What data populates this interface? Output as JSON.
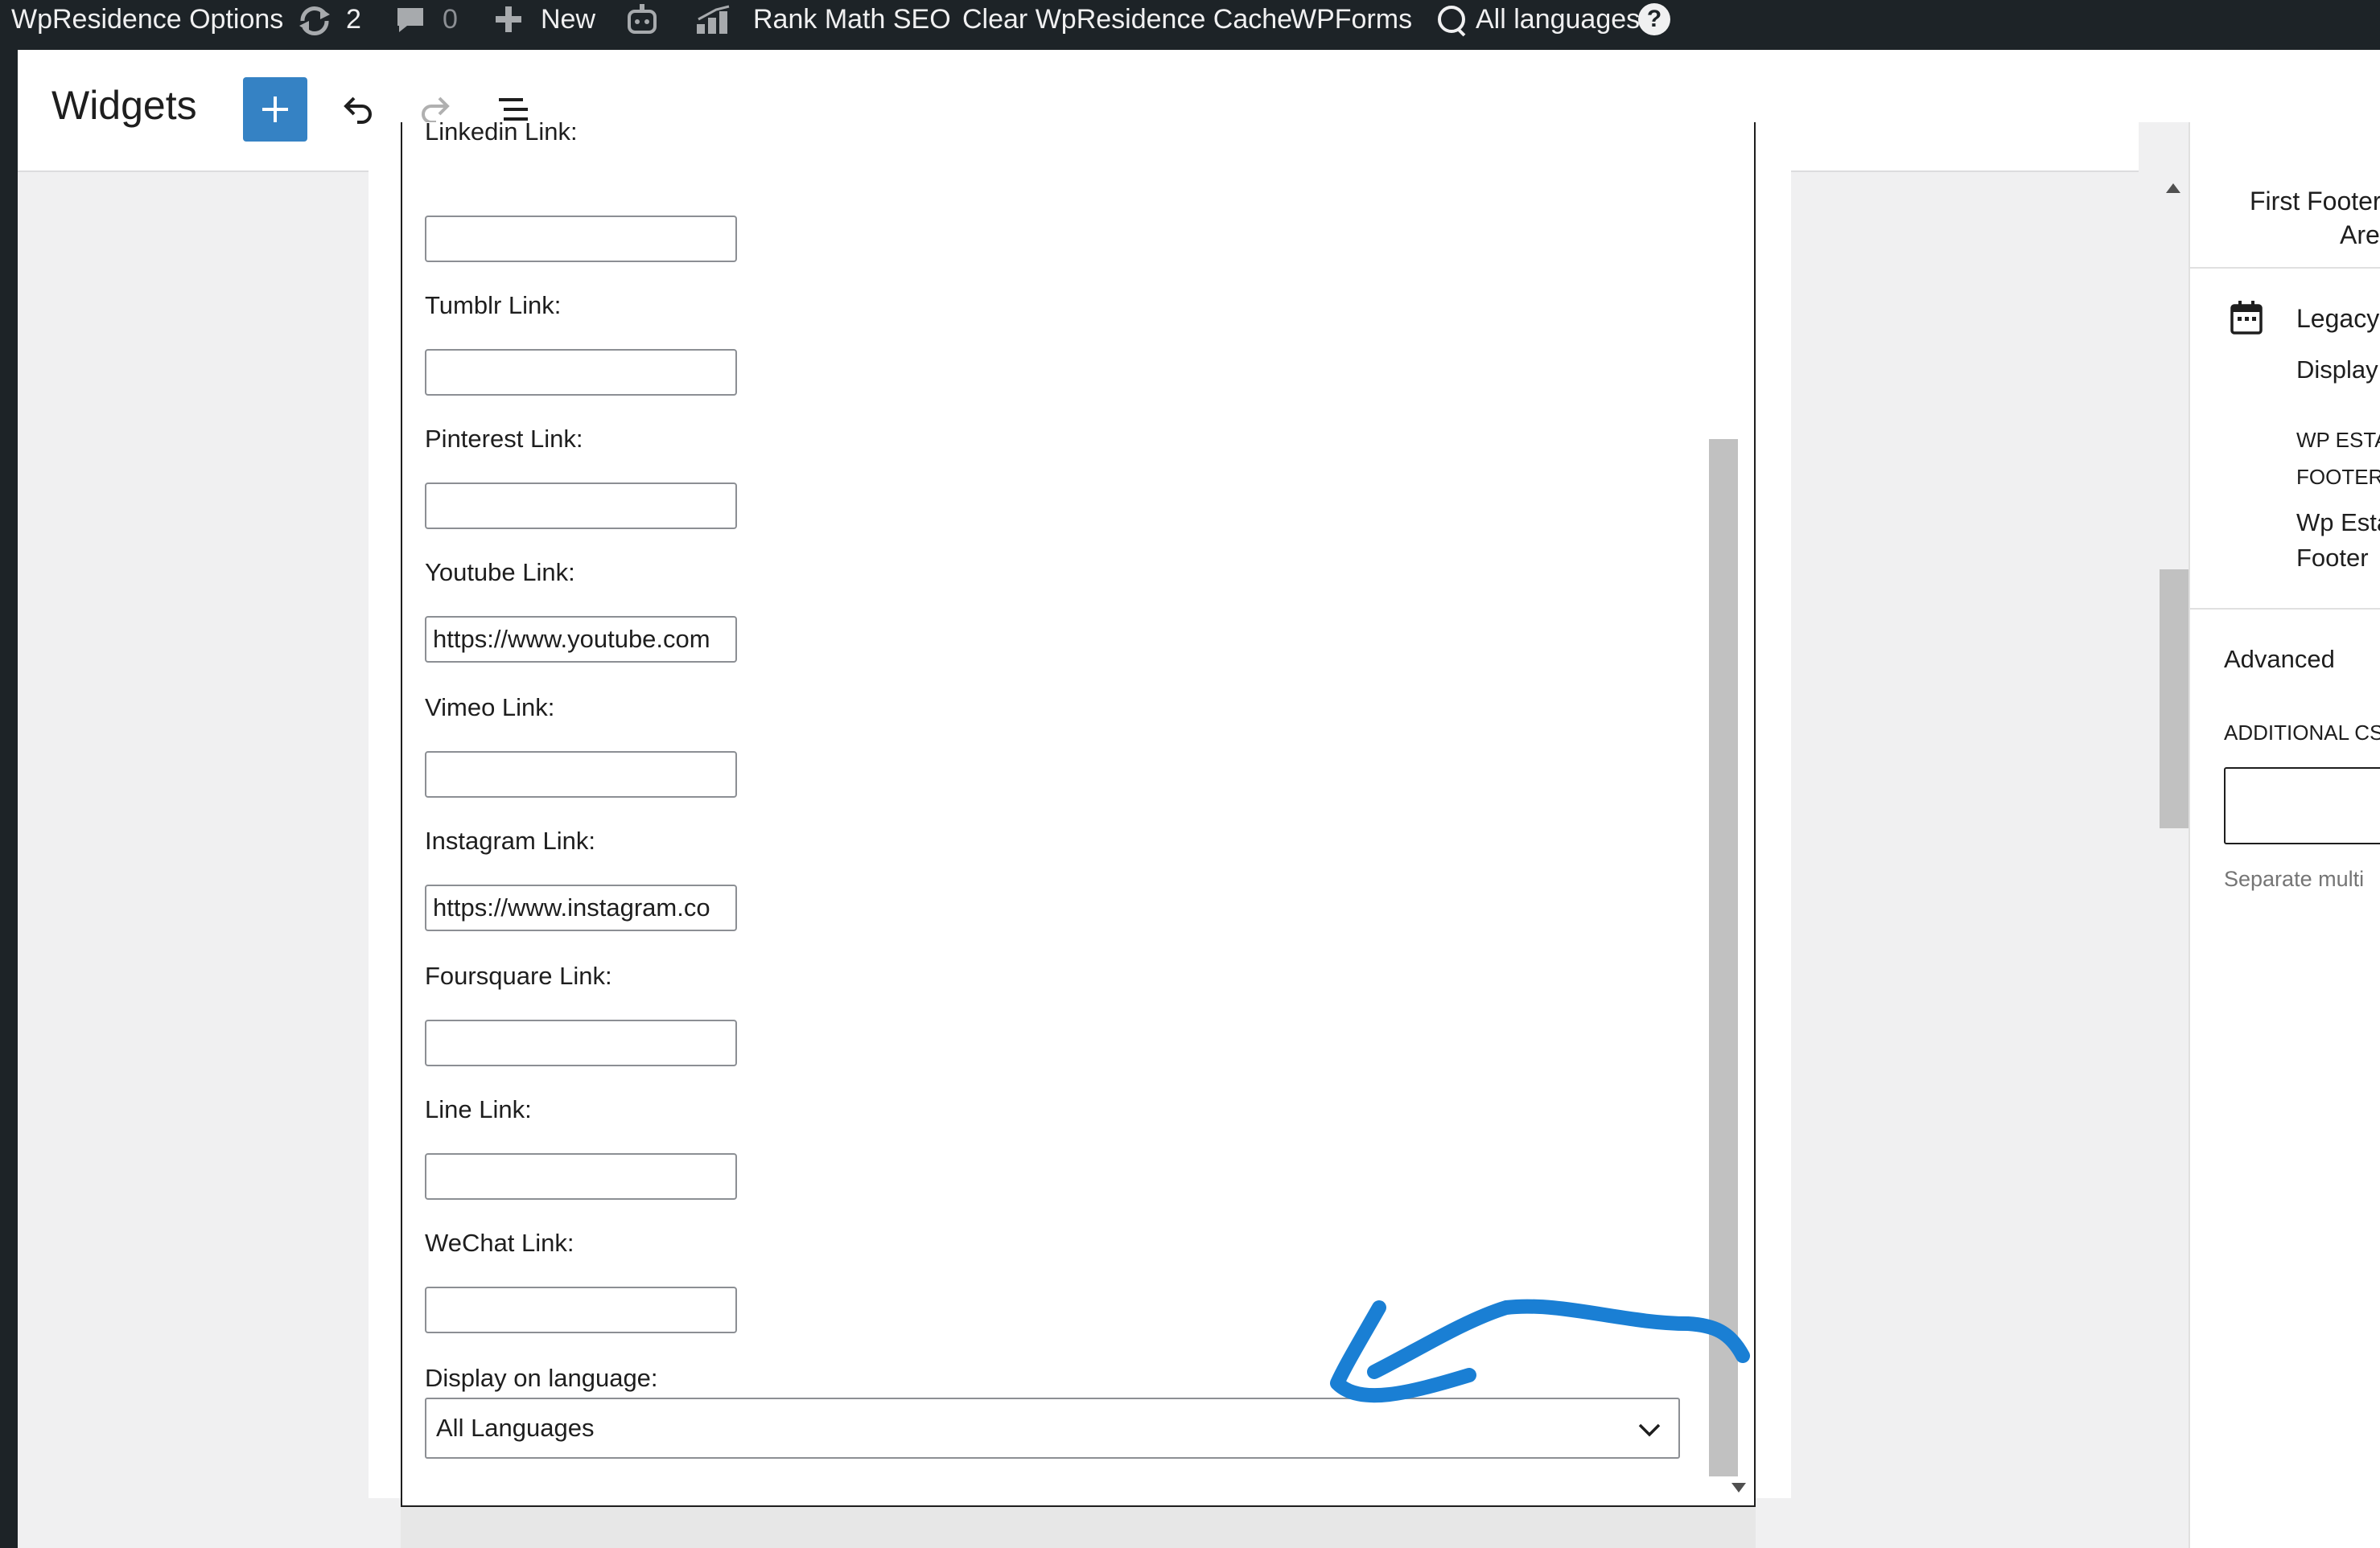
{
  "admin_bar": {
    "site_options": "WpResidence Options",
    "updates_count": "2",
    "comments_count": "0",
    "new_label": "New",
    "rank_math": "Rank Math SEO",
    "clear_cache": "Clear WpResidence Cache",
    "wpforms": "WPForms",
    "languages": "All languages",
    "help_glyph": "?"
  },
  "header": {
    "title": "Widgets",
    "add_glyph": "+"
  },
  "form": {
    "fields": [
      {
        "label": "Linkedin Link:",
        "value": ""
      },
      {
        "label": "Tumblr Link:",
        "value": ""
      },
      {
        "label": "Pinterest Link:",
        "value": ""
      },
      {
        "label": "Youtube Link:",
        "value": "https://www.youtube.com"
      },
      {
        "label": "Vimeo Link:",
        "value": ""
      },
      {
        "label": "Instagram Link:",
        "value": "https://www.instagram.co"
      },
      {
        "label": "Foursquare Link:",
        "value": ""
      },
      {
        "label": "Line Link:",
        "value": ""
      },
      {
        "label": "WeChat Link:",
        "value": ""
      }
    ],
    "language_label": "Display on language:",
    "language_value": "All Languages",
    "annotation_color": "#1a7fd4"
  },
  "sidebar": {
    "area_title_1": "First Footer",
    "area_title_2": "Area",
    "block_title": "Legacy",
    "block_desc": "Display",
    "widget_name_1": "WP ESTA",
    "widget_name_2": "FOOTER",
    "widget_desc_1": "Wp Esta",
    "widget_desc_2": "Footer",
    "advanced": "Advanced",
    "css_label": "ADDITIONAL CS",
    "help_text": "Separate multi"
  },
  "icons": [
    "updates-icon",
    "comment-icon",
    "plus-icon",
    "bot-icon",
    "rank-math-icon",
    "translate-icon",
    "help-icon",
    "undo-icon",
    "redo-icon",
    "list-view-icon",
    "calendar-icon",
    "chevron-down-icon",
    "arrow-annotation-icon"
  ]
}
